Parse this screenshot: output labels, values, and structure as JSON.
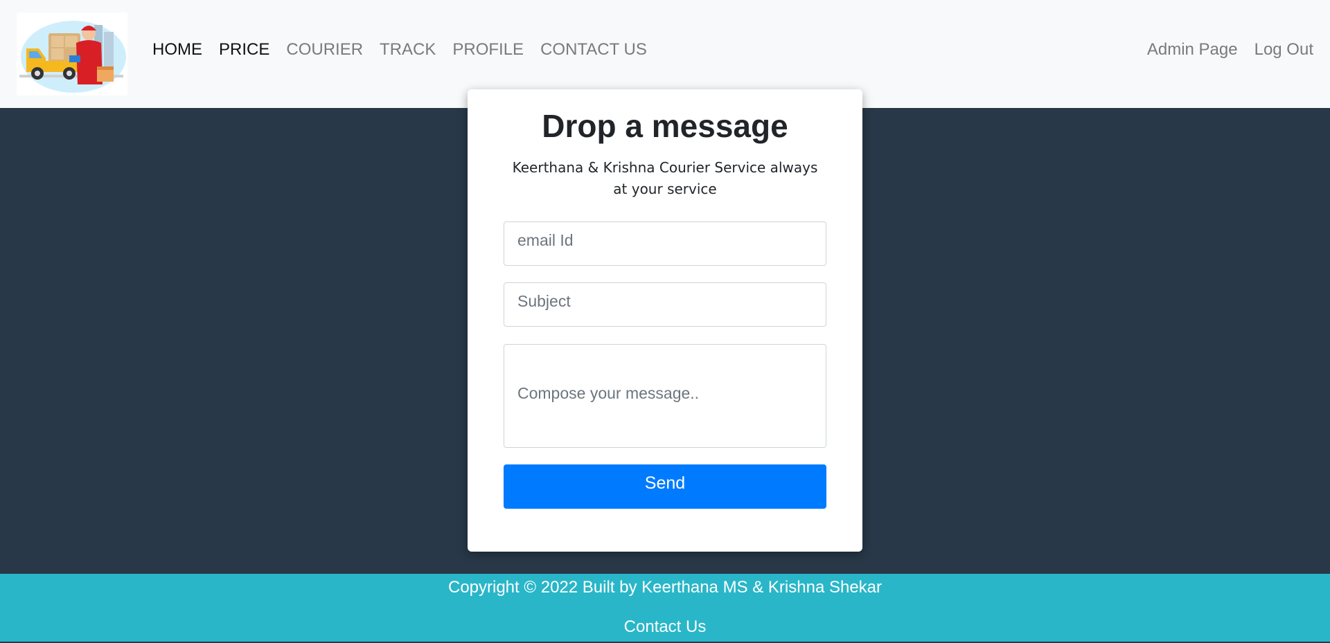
{
  "nav": {
    "logo_alt": "Courier delivery logo",
    "links": [
      {
        "label": "HOME",
        "active": true
      },
      {
        "label": "PRICE",
        "active": true
      },
      {
        "label": "COURIER",
        "active": false
      },
      {
        "label": "TRACK",
        "active": false
      },
      {
        "label": "PROFILE",
        "active": false
      },
      {
        "label": "CONTACT US",
        "active": false
      }
    ],
    "right_links": [
      {
        "label": "Admin Page"
      },
      {
        "label": "Log Out"
      }
    ]
  },
  "form": {
    "title": "Drop a message",
    "tagline": "Keerthana & Krishna Courier Service always at your service",
    "email_placeholder": "email Id",
    "subject_placeholder": "Subject",
    "message_placeholder": "Compose your message..",
    "send_label": "Send"
  },
  "footer": {
    "copyright": "Copyright © 2022 Built by Keerthana MS & Krishna Shekar",
    "contact_label": "Contact Us"
  },
  "colors": {
    "background": "#283848",
    "navbar": "#f8f9fa",
    "primary_button": "#007bff",
    "footer": "#29b6c8"
  }
}
